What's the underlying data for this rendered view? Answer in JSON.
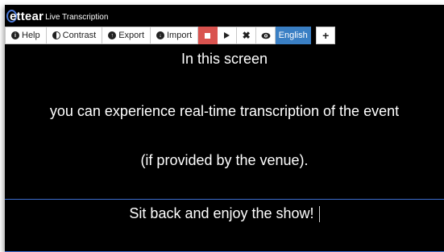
{
  "titlebar": {
    "logo": "ettear",
    "logo_initial": "B",
    "app_title": "Live Transcription"
  },
  "toolbar": {
    "help_label": "Help",
    "contrast_label": "Contrast",
    "export_label": "Export",
    "import_label": "Import",
    "close_glyph": "✖",
    "plus_glyph": "+",
    "language_label": "English"
  },
  "transcript": {
    "lines": [
      "In this screen",
      "you can experience real-time transcription of the event",
      "(if provided by the venue)."
    ],
    "current_line": "Sit back and enjoy the show!"
  },
  "colors": {
    "background": "#000000",
    "stop_button": "#d9534f",
    "language_button": "#3a7fc4",
    "separator": "#3d6fd1"
  }
}
